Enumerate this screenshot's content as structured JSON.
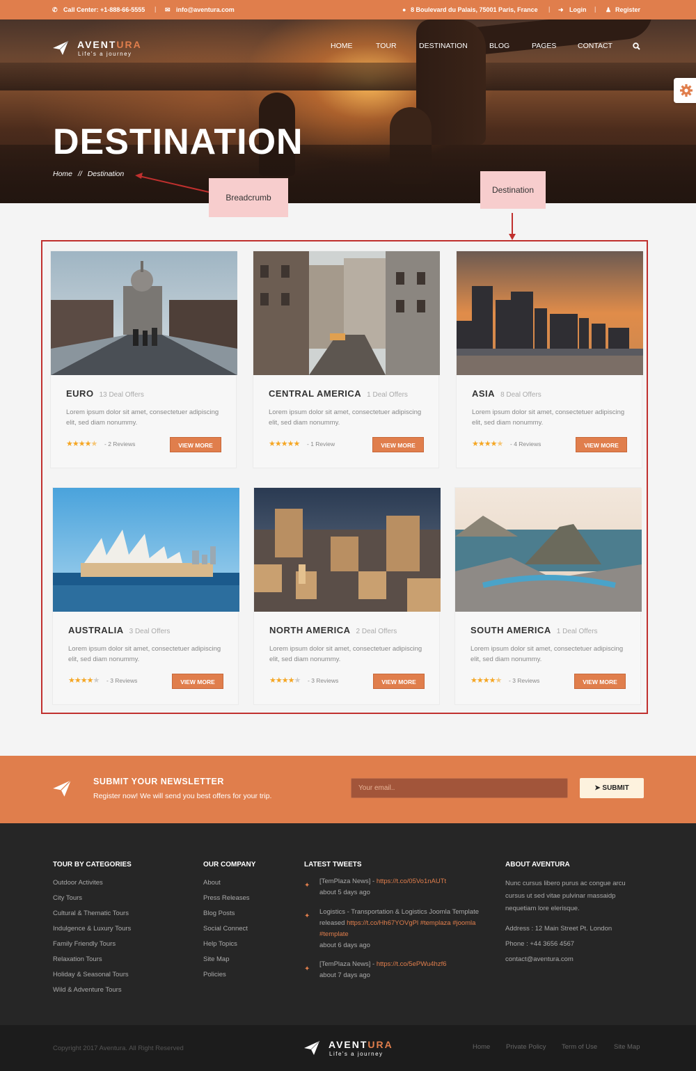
{
  "topbar": {
    "call_center": "Call Center: +1-888-66-5555",
    "email": "info@aventura.com",
    "address": "8 Boulevard du Palais, 75001 Paris, France",
    "login": "Login",
    "register": "Register"
  },
  "brand": {
    "name_a": "AVENT",
    "name_b": "URA",
    "tagline": "Life's a journey"
  },
  "nav": [
    "HOME",
    "TOUR",
    "DESTINATION",
    "BLOG",
    "PAGES",
    "CONTACT"
  ],
  "hero": {
    "title": "DESTINATION",
    "breadcrumb_home": "Home",
    "breadcrumb_sep": "//",
    "breadcrumb_current": "Destination"
  },
  "annotations": {
    "breadcrumb": "Breadcrumb",
    "destination": "Destination"
  },
  "cards": [
    {
      "title": "EURO",
      "offers": "13 Deal Offers",
      "desc": "Lorem ipsum dolor sit amet, consectetuer adipiscing elit, sed diam nonummy.",
      "rating": 4.5,
      "reviews": "- 2 Reviews",
      "button": "VIEW MORE"
    },
    {
      "title": "CENTRAL AMERICA",
      "offers": "1 Deal Offers",
      "desc": "Lorem ipsum dolor sit amet, consectetuer adipiscing elit, sed diam nonummy.",
      "rating": 5,
      "reviews": "- 1 Review",
      "button": "VIEW MORE"
    },
    {
      "title": "ASIA",
      "offers": "8 Deal Offers",
      "desc": "Lorem ipsum dolor sit amet, consectetuer adipiscing elit, sed diam nonummy.",
      "rating": 4.5,
      "reviews": "- 4 Reviews",
      "button": "VIEW MORE"
    },
    {
      "title": "AUSTRALIA",
      "offers": "3 Deal Offers",
      "desc": "Lorem ipsum dolor sit amet, consectetuer adipiscing elit, sed diam nonummy.",
      "rating": 4,
      "reviews": "- 3 Reviews",
      "button": "VIEW MORE"
    },
    {
      "title": "NORTH AMERICA",
      "offers": "2 Deal Offers",
      "desc": "Lorem ipsum dolor sit amet, consectetuer adipiscing elit, sed diam nonummy.",
      "rating": 4,
      "reviews": "- 3 Reviews",
      "button": "VIEW MORE"
    },
    {
      "title": "SOUTH AMERICA",
      "offers": "1 Deal Offers",
      "desc": "Lorem ipsum dolor sit amet, consectetuer adipiscing elit, sed diam nonummy.",
      "rating": 4.5,
      "reviews": "- 3 Reviews",
      "button": "VIEW MORE"
    }
  ],
  "newsletter": {
    "title": "SUBMIT YOUR NEWSLETTER",
    "subtitle": "Register now! We will send you best offers for your trip.",
    "placeholder": "Your email..",
    "button": "SUBMIT"
  },
  "footer": {
    "col1": {
      "title": "TOUR BY CATEGORIES",
      "links": [
        "Outdoor Activites",
        "City Tours",
        "Cultural & Thematic Tours",
        "Indulgence & Luxury Tours",
        "Family Friendly Tours",
        "Relaxation Tours",
        "Holiday & Seasonal Tours",
        "Wild & Adventure Tours"
      ]
    },
    "col2": {
      "title": "OUR COMPANY",
      "links": [
        "About",
        "Press Releases",
        "Blog Posts",
        "Social Connect",
        "Help Topics",
        "Site Map",
        "Policies"
      ]
    },
    "col3": {
      "title": "LATEST TWEETS",
      "tweets": [
        {
          "text": "[TemPlaza News] - ",
          "link": "https://t.co/05Vo1nAUTt",
          "tags": "",
          "time": "about 5 days ago"
        },
        {
          "text": "Logistics - Transportation & Logistics Joomla Template released ",
          "link": "https://t.co/Hh67YOVgPl",
          "tags": " #templaza #joomla #template",
          "time": "about 6 days ago"
        },
        {
          "text": "[TemPlaza News] - ",
          "link": "https://t.co/5ePWu4hzf6",
          "tags": "",
          "time": "about 7 days ago"
        }
      ]
    },
    "col4": {
      "title": "ABOUT AVENTURA",
      "about": "Nunc cursus libero purus ac congue arcu cursus ut sed vitae pulvinar massaidp nequetiam lore elerisque.",
      "address": "Address : 12 Main Street Pt. London",
      "phone": "Phone : +44 3656 4567",
      "email": "contact@aventura.com"
    }
  },
  "bottom": {
    "copyright": "Copyright 2017 Aventura. All Right Reserved",
    "links": [
      "Home",
      "Private Policy",
      "Term of Use",
      "Site Map"
    ]
  },
  "colors": {
    "accent": "#e07e4c",
    "dark": "#262626",
    "annotation": "#c0302e"
  }
}
